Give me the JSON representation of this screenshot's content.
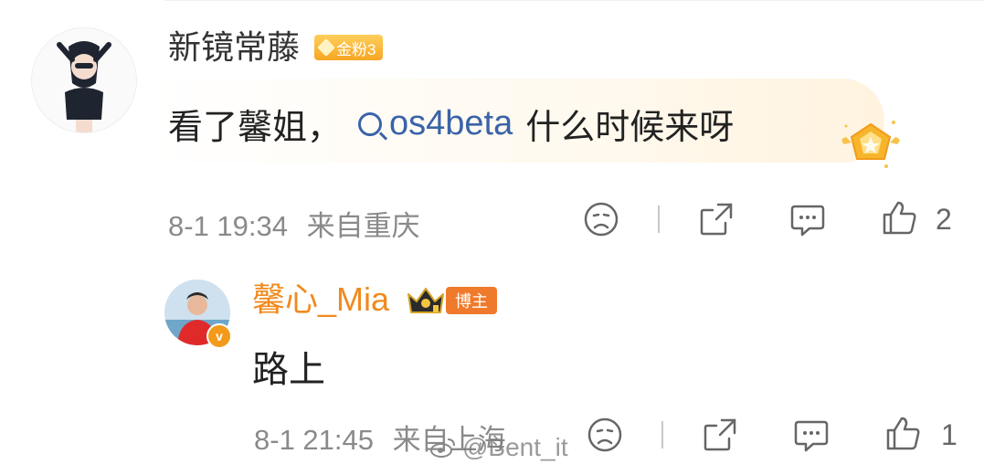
{
  "comment": {
    "username": "新镜常藤",
    "fan_badge": "金粉3",
    "text_prefix": "看了馨姐，",
    "search_term": "os4beta",
    "text_suffix": "什么时候来呀",
    "timestamp": "8-1 19:34",
    "location": "来自重庆",
    "like_count": "2",
    "icons": [
      "dislike-face-icon",
      "share-icon",
      "comment-icon",
      "thumbs-up-icon"
    ]
  },
  "reply": {
    "username": "馨心_Mia",
    "role_badge": "博主",
    "text": "路上",
    "timestamp": "8-1 21:45",
    "location": "来自上海",
    "like_count": "1",
    "verified_mark": "v"
  },
  "watermark": {
    "text": "@Bent_it"
  },
  "colors": {
    "blogger_name": "#f08a1e",
    "link": "#3a63a8",
    "meta": "#8a8a8a",
    "fan_badge": "#f6a623",
    "blogger_badge": "#f07a2b"
  }
}
